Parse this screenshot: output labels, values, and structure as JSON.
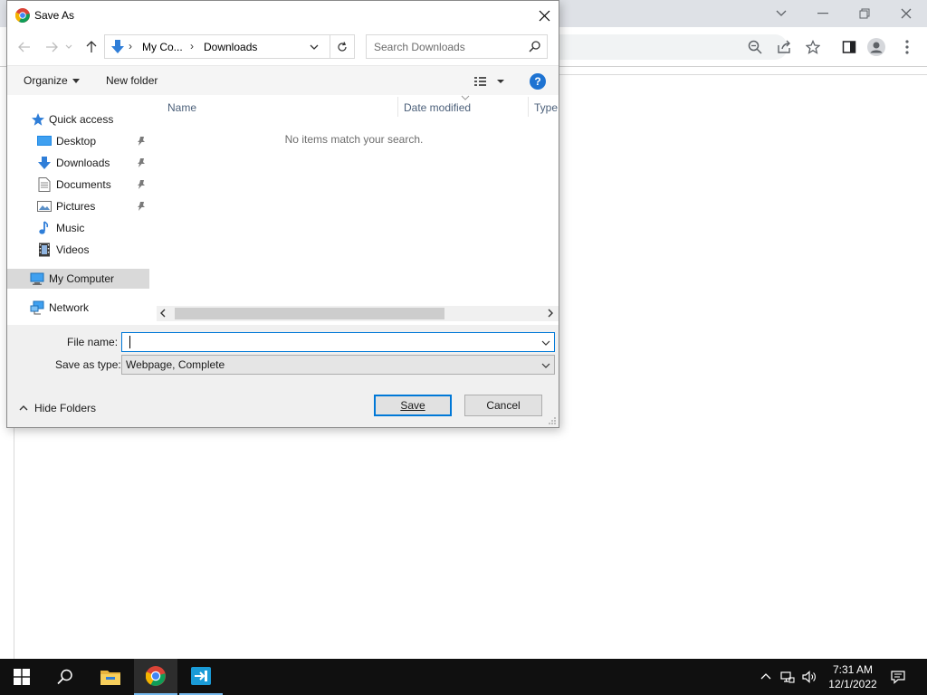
{
  "dialog": {
    "title": "Save As",
    "breadcrumb": [
      "My Co...",
      "Downloads"
    ],
    "search_placeholder": "Search Downloads",
    "organize_label": "Organize",
    "new_folder_label": "New folder",
    "help_glyph": "?",
    "nav_items": [
      {
        "label": "Quick access",
        "icon": "star-icon"
      },
      {
        "label": "Desktop",
        "icon": "desktop-icon",
        "pinned": true
      },
      {
        "label": "Downloads",
        "icon": "download-arrow-icon",
        "pinned": true
      },
      {
        "label": "Documents",
        "icon": "document-icon",
        "pinned": true
      },
      {
        "label": "Pictures",
        "icon": "picture-icon",
        "pinned": true
      },
      {
        "label": "Music",
        "icon": "music-note-icon"
      },
      {
        "label": "Videos",
        "icon": "film-icon"
      },
      {
        "label": "My Computer",
        "icon": "computer-icon",
        "selected": true
      },
      {
        "label": "Network",
        "icon": "network-icon"
      }
    ],
    "columns": [
      "Name",
      "Date modified",
      "Type"
    ],
    "empty_message": "No items match your search.",
    "file_name_label": "File name:",
    "file_name_value": "",
    "save_as_type_label": "Save as type:",
    "save_as_type_value": "Webpage, Complete",
    "hide_folders_label": "Hide Folders",
    "save_button_label": "Save",
    "cancel_button_label": "Cancel"
  },
  "taskbar": {
    "time": "7:31 AM",
    "date": "12/1/2022"
  },
  "colors": {
    "accent": "#0078d7",
    "taskbar": "#101010",
    "dialog_bg": "#f0f0f0",
    "help_blue": "#1e73d2"
  }
}
